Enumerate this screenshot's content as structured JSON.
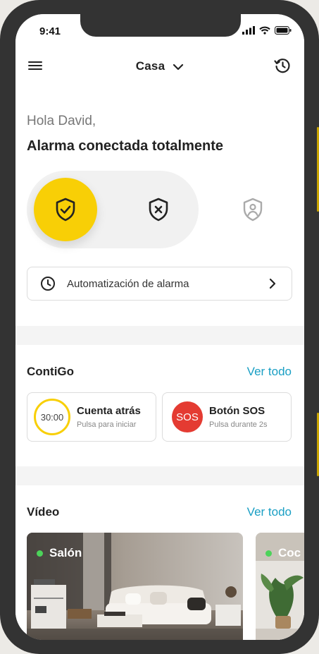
{
  "status": {
    "time": "9:41"
  },
  "nav": {
    "title": "Casa"
  },
  "greeting": "Hola David,",
  "alarm_status": "Alarma conectada totalmente",
  "automation": {
    "label": "Automatización de alarma"
  },
  "contigo": {
    "title": "ContiGo",
    "link": "Ver todo",
    "cards": [
      {
        "badge": "30:00",
        "title": "Cuenta atrás",
        "subtitle": "Pulsa para iniciar"
      },
      {
        "badge": "SOS",
        "title": "Botón SOS",
        "subtitle": "Pulsa durante 2s"
      }
    ]
  },
  "video": {
    "title": "Vídeo",
    "link": "Ver todo",
    "cameras": [
      {
        "name": "Salón"
      },
      {
        "name": "Coc"
      }
    ]
  },
  "colors": {
    "accent": "#f8cf06",
    "link": "#1a9fc4",
    "sos": "#e43b32",
    "online": "#4cd35a"
  }
}
